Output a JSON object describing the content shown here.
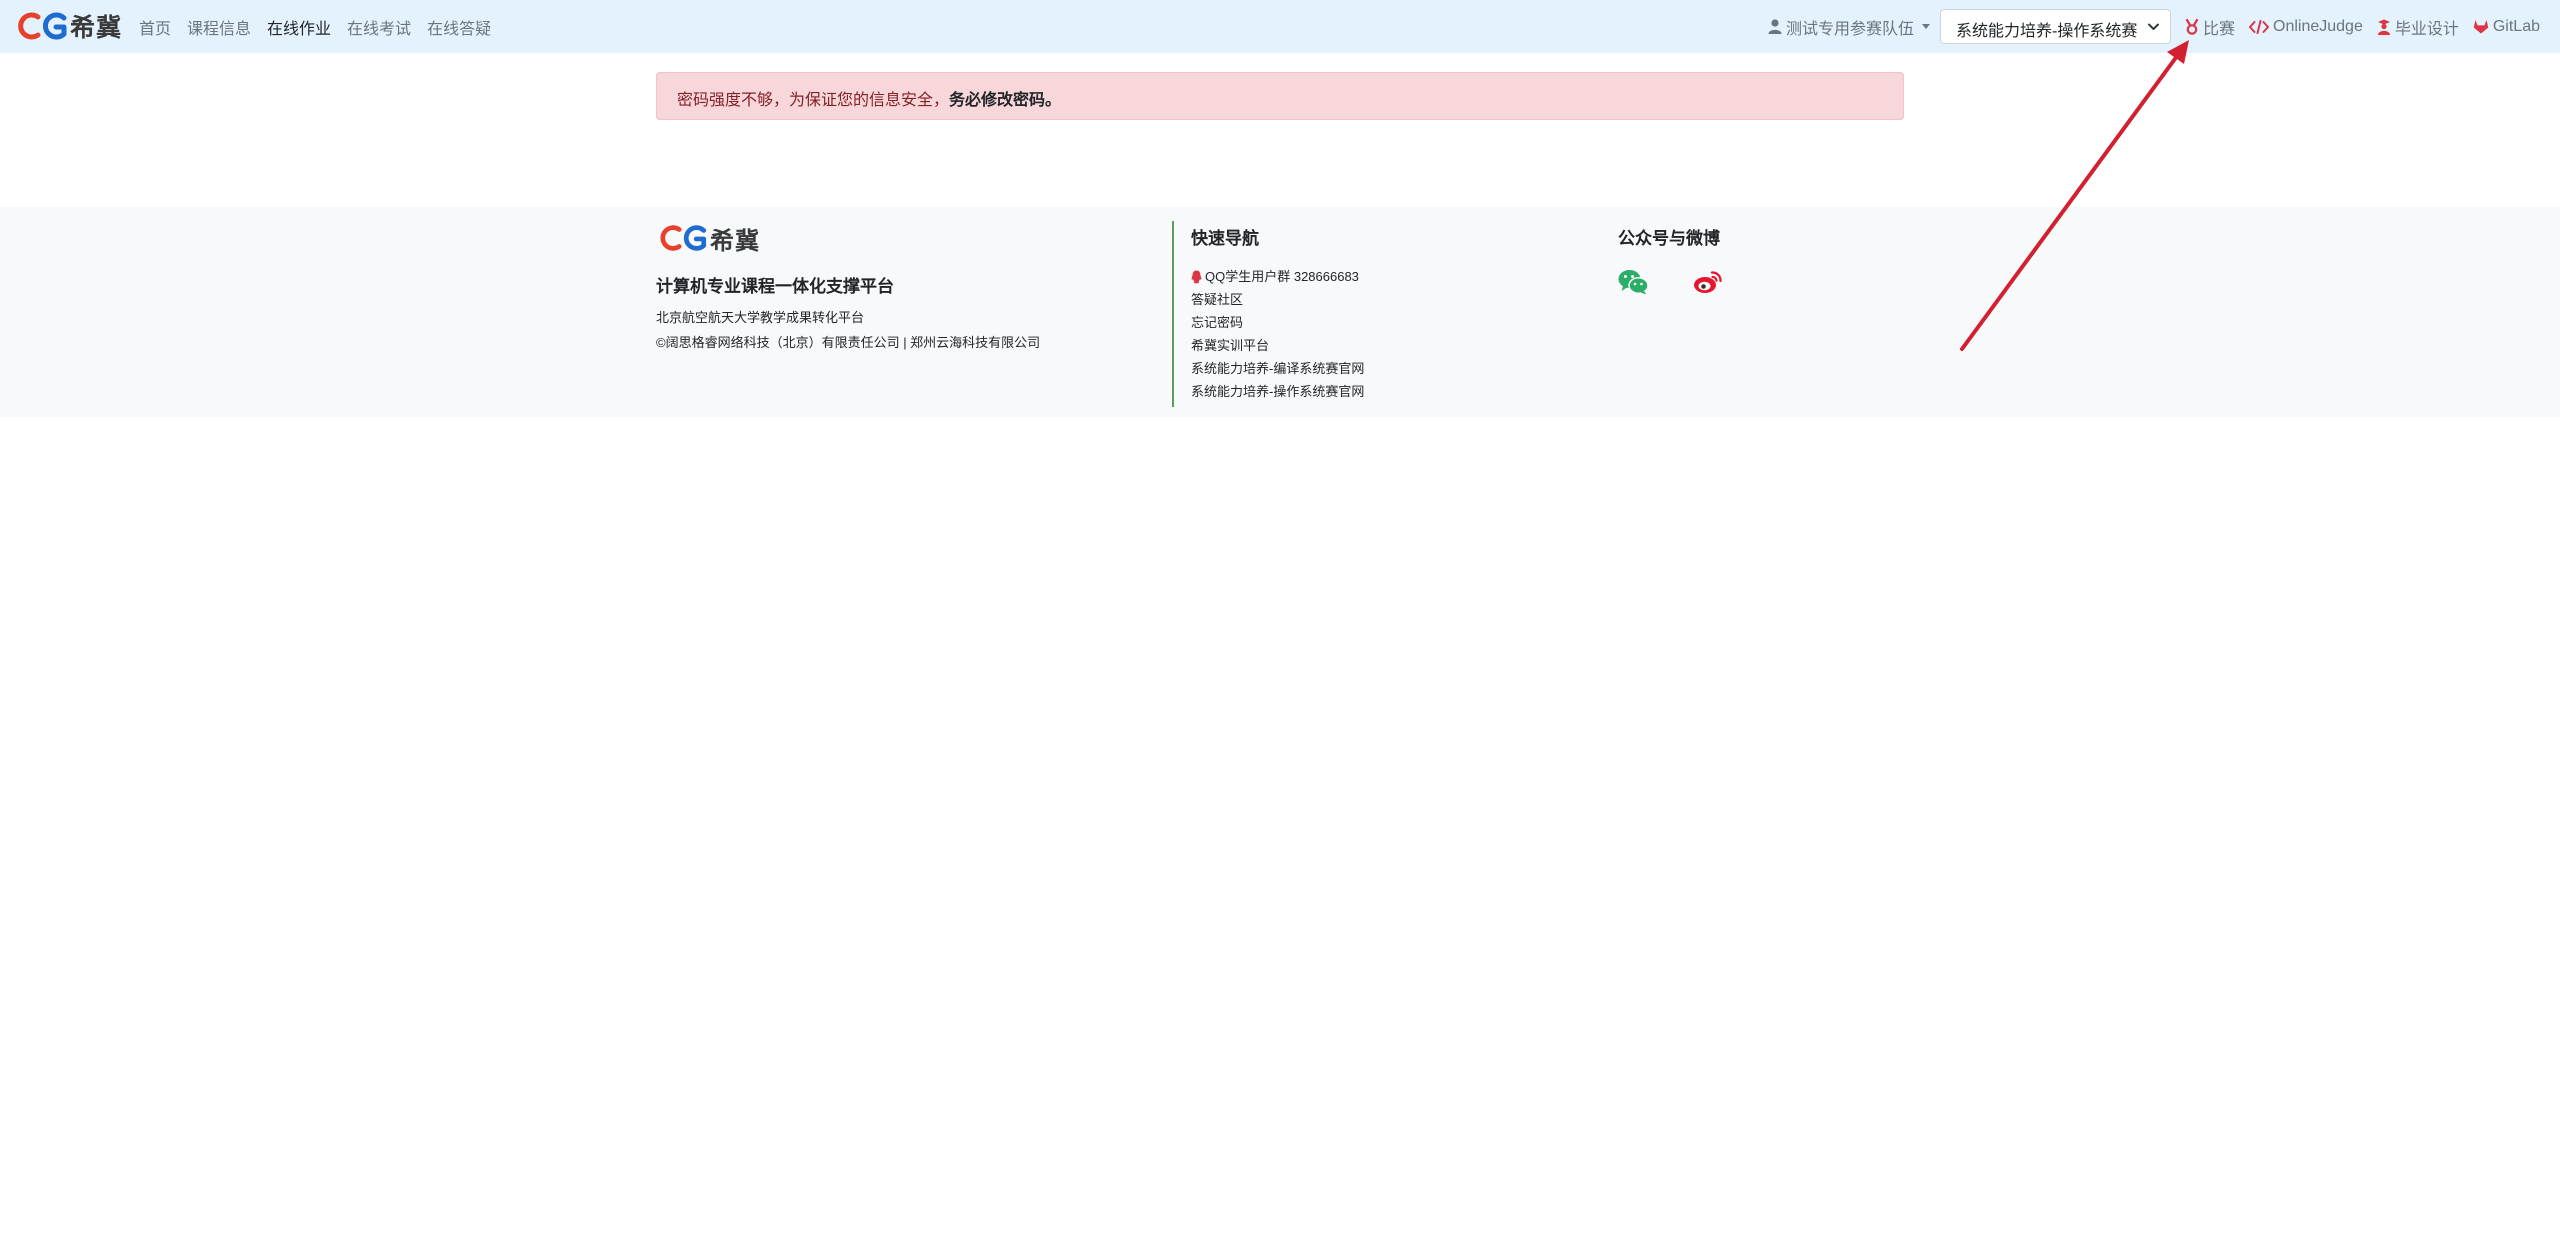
{
  "navbar": {
    "brand": "希冀",
    "links": [
      {
        "label": "首页"
      },
      {
        "label": "课程信息"
      },
      {
        "label": "在线作业",
        "active": true
      },
      {
        "label": "在线考试"
      },
      {
        "label": "在线答疑"
      }
    ],
    "team": "测试专用参赛队伍",
    "competition_select": "系统能力培养-操作系统赛",
    "right_links": {
      "contest": "比赛",
      "onlinejudge": "OnlineJudge",
      "graduation": "毕业设计",
      "gitlab": "GitLab"
    }
  },
  "alert": {
    "text": "密码强度不够，为保证您的信息安全，",
    "strong": "务必修改密码。"
  },
  "footer": {
    "brand": "希冀",
    "title": "计算机专业课程一体化支撑平台",
    "line1": "北京航空航天大学教学成果转化平台",
    "line2": "©阔思格睿网络科技（北京）有限责任公司 | 郑州云海科技有限公司",
    "quick_nav": {
      "heading": "快速导航",
      "items": [
        "QQ学生用户群 328666683",
        "答疑社区",
        "忘记密码",
        "希冀实训平台",
        "系统能力培养-编译系统赛官网",
        "系统能力培养-操作系统赛官网"
      ]
    },
    "social": {
      "heading": "公众号与微博",
      "icons": [
        "wechat-icon",
        "weibo-icon"
      ]
    }
  },
  "colors": {
    "navbar_bg": "#e3f2fd",
    "alert_bg": "#f8d7da",
    "alert_text": "#842029",
    "accent_red": "#dc3545",
    "wechat_green": "#2aae67",
    "weibo_red": "#e6162d",
    "logo_red": "#e8412b",
    "logo_blue": "#1e6ccf",
    "annotation_arrow": "#d32030"
  }
}
